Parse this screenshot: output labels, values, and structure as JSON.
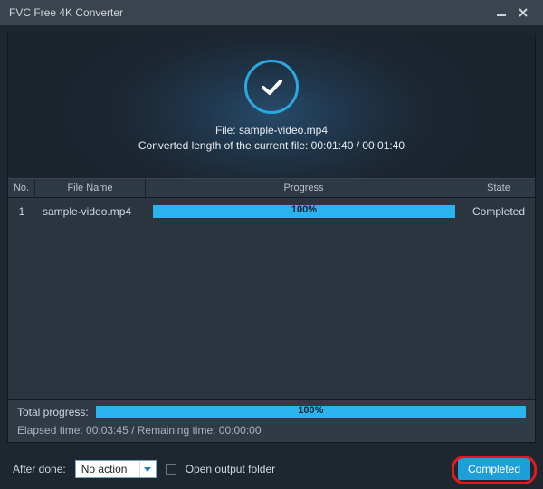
{
  "titlebar": {
    "title": "FVC Free 4K Converter"
  },
  "hero": {
    "file_label": "File: sample-video.mp4",
    "converted_line": "Converted length of the current file: 00:01:40 / 00:01:40"
  },
  "columns": {
    "no": "No.",
    "file_name": "File Name",
    "progress": "Progress",
    "state": "State"
  },
  "rows": [
    {
      "no": "1",
      "name": "sample-video.mp4",
      "pct": "100%",
      "state": "Completed"
    }
  ],
  "totals": {
    "label": "Total progress:",
    "pct": "100%",
    "elapsed_line": "Elapsed time: 00:03:45 / Remaining time: 00:00:00"
  },
  "footer": {
    "after_done_label": "After done:",
    "select_value": "No action",
    "open_output_label": "Open output folder",
    "completed_button": "Completed"
  }
}
